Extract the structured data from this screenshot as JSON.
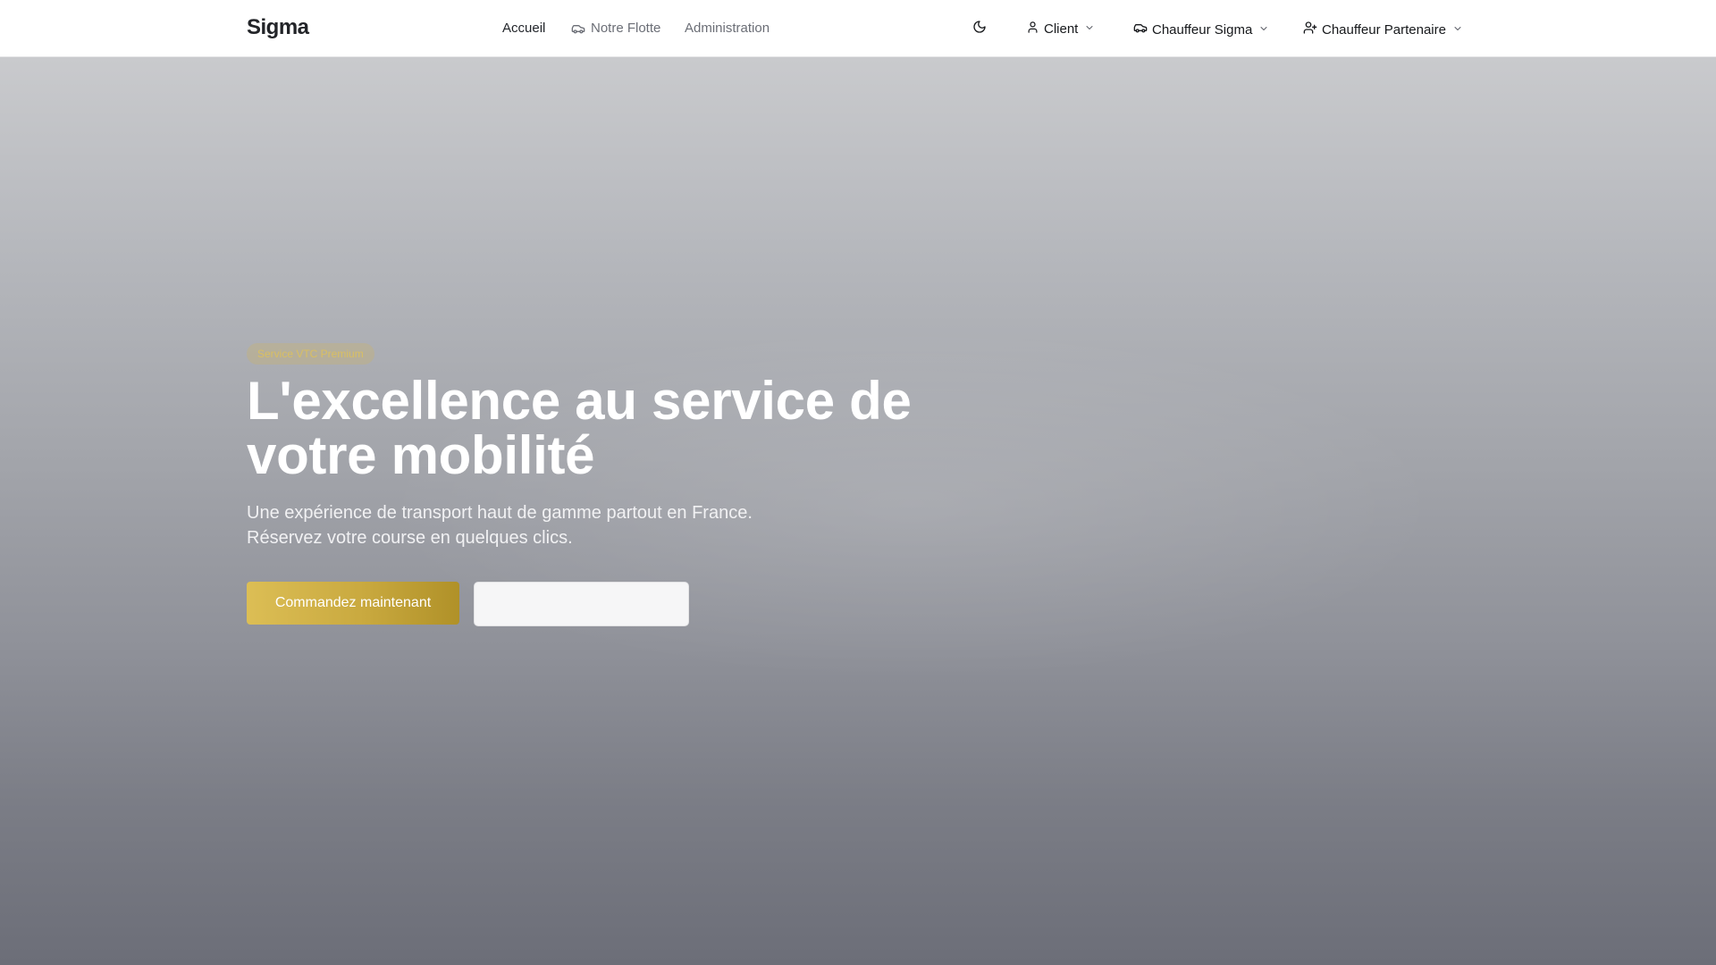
{
  "brand": "Sigma",
  "nav": {
    "links": [
      {
        "label": "Accueil",
        "icon": ""
      },
      {
        "label": "Notre Flotte",
        "icon": "car-icon"
      },
      {
        "label": "Administration",
        "icon": ""
      }
    ],
    "theme_toggle_icon": "moon-icon",
    "menus": [
      {
        "label": "Client",
        "icon": "user-icon"
      },
      {
        "label": "Chauffeur Sigma",
        "icon": "car-icon"
      },
      {
        "label": "Chauffeur Partenaire",
        "icon": "user-plus-icon"
      }
    ]
  },
  "hero": {
    "badge": "Service VTC Premium",
    "title": "L'excellence au service de votre mobilité",
    "subtitle_lines": [
      "Une expérience de transport haut de gamme partout en France.",
      "Réservez votre course en quelques clics."
    ],
    "primary_button": "Commandez maintenant",
    "secondary_button": ""
  },
  "colors": {
    "accent_gold": "#c9a93f",
    "navbar_bg": "#ffffff",
    "hero_top": "#c9cacd",
    "hero_bottom": "#6c6e78"
  }
}
